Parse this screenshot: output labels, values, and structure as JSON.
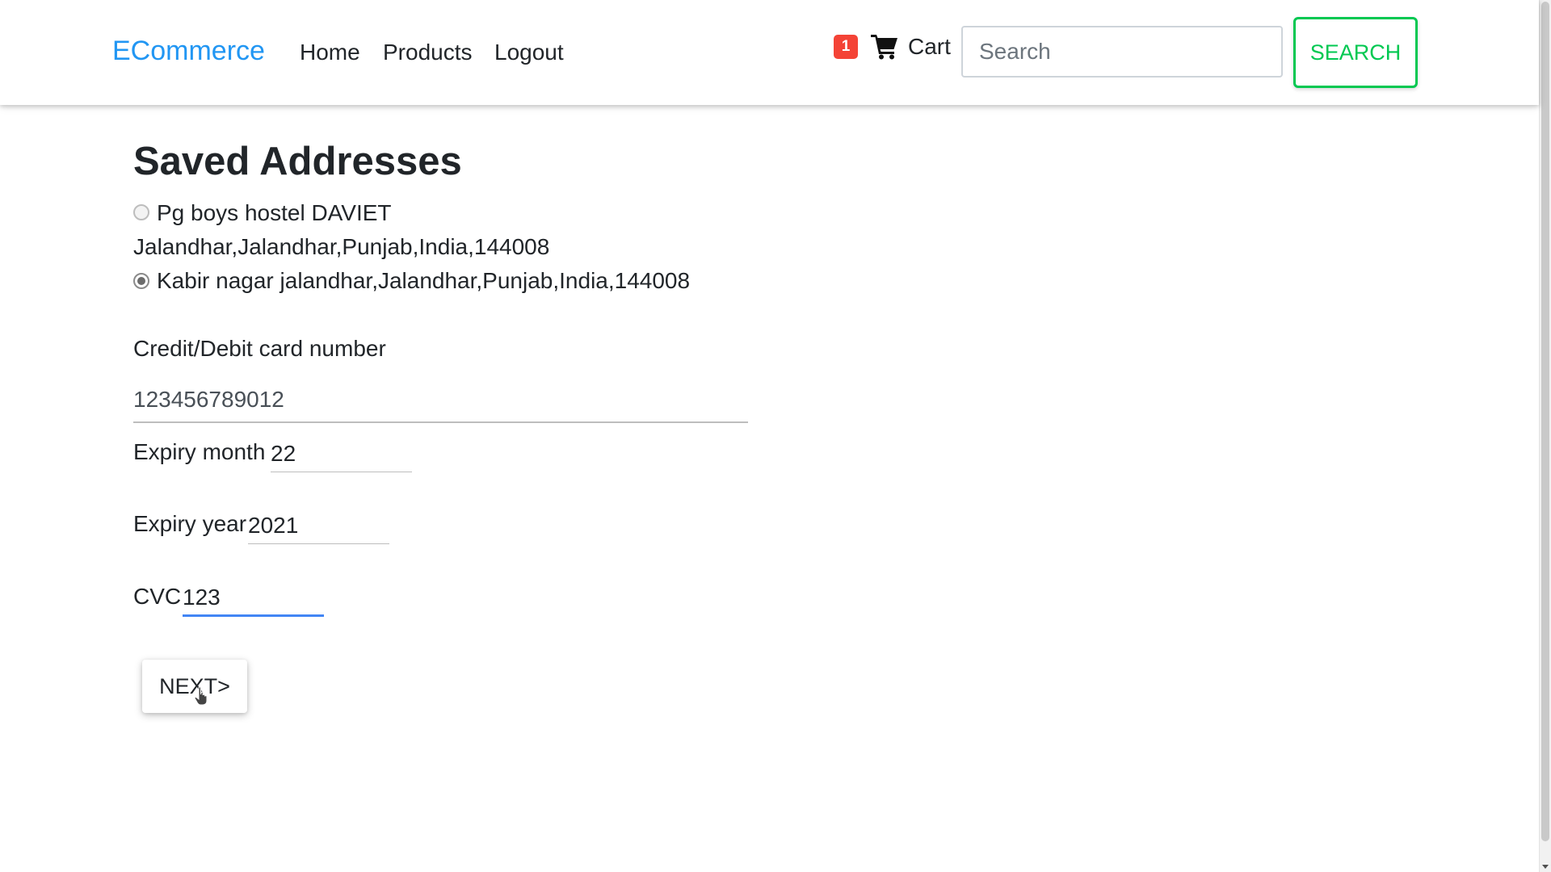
{
  "navbar": {
    "brand": "ECommerce",
    "links": {
      "home": "Home",
      "products": "Products",
      "logout": "Logout"
    },
    "cart": {
      "count": "1",
      "label": "Cart",
      "icon": "shopping-cart-icon"
    },
    "search": {
      "placeholder": "Search",
      "button_label": "SEARCH"
    }
  },
  "colors": {
    "brand": "#2196f3",
    "badge": "#f44336",
    "search_button": "#00c851",
    "focus_underline": "#4285f4"
  },
  "addresses": {
    "title": "Saved Addresses",
    "items": [
      {
        "line1": "Pg boys hostel DAVIET",
        "line2": "Jalandhar,Jalandhar,Punjab,India,144008",
        "selected": false
      },
      {
        "line1": "Kabir nagar jalandhar,Jalandhar,Punjab,India,144008",
        "selected": true
      }
    ]
  },
  "payment": {
    "card_label": "Credit/Debit card number",
    "card_value": "123456789012",
    "month_label": "Expiry month",
    "month_value": "22",
    "year_label": "Expiry year",
    "year_value": "2021",
    "cvc_label": "CVC",
    "cvc_value": "123",
    "next_label": "NEXT>"
  }
}
